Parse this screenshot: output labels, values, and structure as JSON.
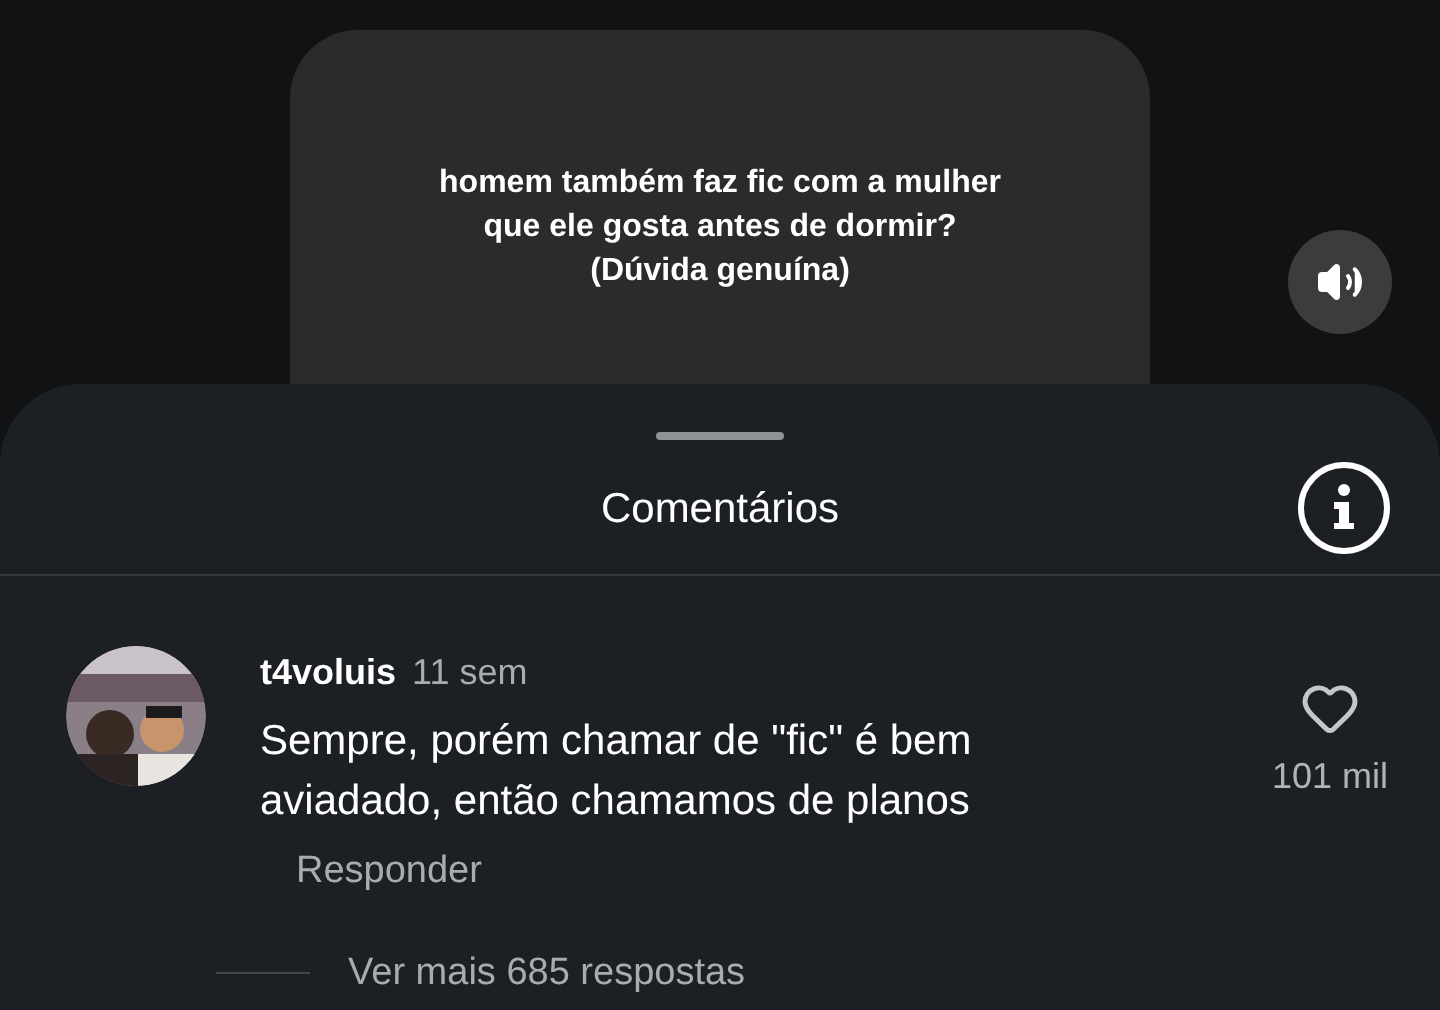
{
  "video": {
    "caption_lines": [
      "homem também faz fic com a mulher",
      "que ele gosta antes de dormir?",
      "(Dúvida genuína)"
    ]
  },
  "sound_button": {
    "muted": false
  },
  "sheet": {
    "title": "Comentários"
  },
  "comments": [
    {
      "username": "t4voluis",
      "time": "11 sem",
      "text": "Sempre, porém chamar de \"fic\" é bem aviadado, então chamamos de planos",
      "liked": false,
      "likes": "101 mil",
      "reply_label": "Responder",
      "more_replies": "Ver mais 685 respostas"
    }
  ]
}
